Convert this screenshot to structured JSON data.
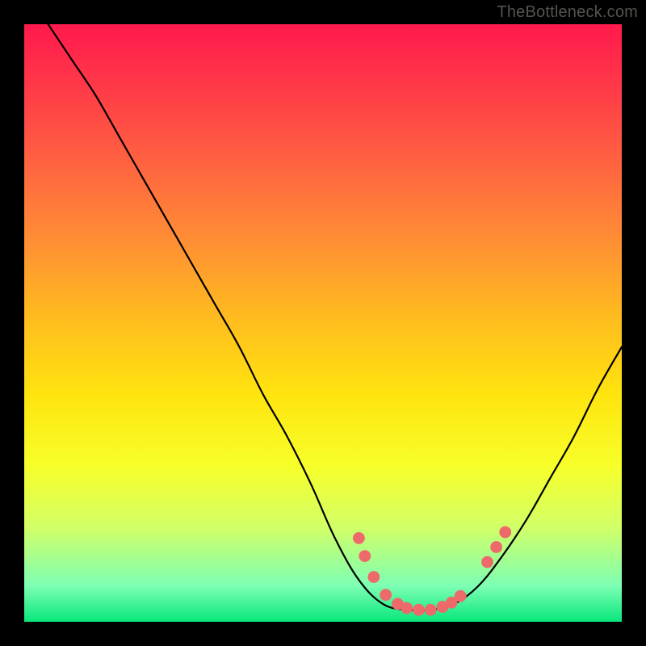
{
  "watermark": "TheBottleneck.com",
  "chart_data": {
    "type": "line",
    "title": "",
    "xlabel": "",
    "ylabel": "",
    "xlim": [
      0,
      100
    ],
    "ylim": [
      0,
      100
    ],
    "series": [
      {
        "name": "bottleneck-curve",
        "color": "#000000",
        "x": [
          4,
          8,
          12,
          16,
          20,
          24,
          28,
          32,
          36,
          40,
          44,
          48,
          52,
          56,
          60,
          64,
          68,
          72,
          76,
          80,
          84,
          88,
          92,
          96,
          100
        ],
        "y": [
          100,
          94,
          88,
          81,
          74,
          67,
          60,
          53,
          46,
          38,
          31,
          23,
          14,
          7,
          3,
          2,
          2,
          3,
          6,
          11,
          17,
          24,
          31,
          39,
          46
        ]
      }
    ],
    "markers": {
      "name": "highlight-points",
      "color": "#ee6a6a",
      "radius_pct": 1.0,
      "x": [
        56.0,
        57.0,
        58.5,
        60.5,
        62.5,
        64.0,
        66.0,
        68.0,
        70.0,
        71.5,
        73.0,
        77.5,
        79.0,
        80.5
      ],
      "y": [
        14.0,
        11.0,
        7.5,
        4.5,
        3.0,
        2.3,
        2.0,
        2.0,
        2.5,
        3.2,
        4.3,
        10.0,
        12.5,
        15.0
      ]
    },
    "background_gradient": {
      "stops": [
        {
          "pct": 0,
          "color": "#ff1a4d"
        },
        {
          "pct": 20,
          "color": "#ff5843"
        },
        {
          "pct": 48,
          "color": "#ffb820"
        },
        {
          "pct": 74,
          "color": "#f7ff2a"
        },
        {
          "pct": 94,
          "color": "#7dffb3"
        },
        {
          "pct": 100,
          "color": "#08e77b"
        }
      ]
    }
  }
}
